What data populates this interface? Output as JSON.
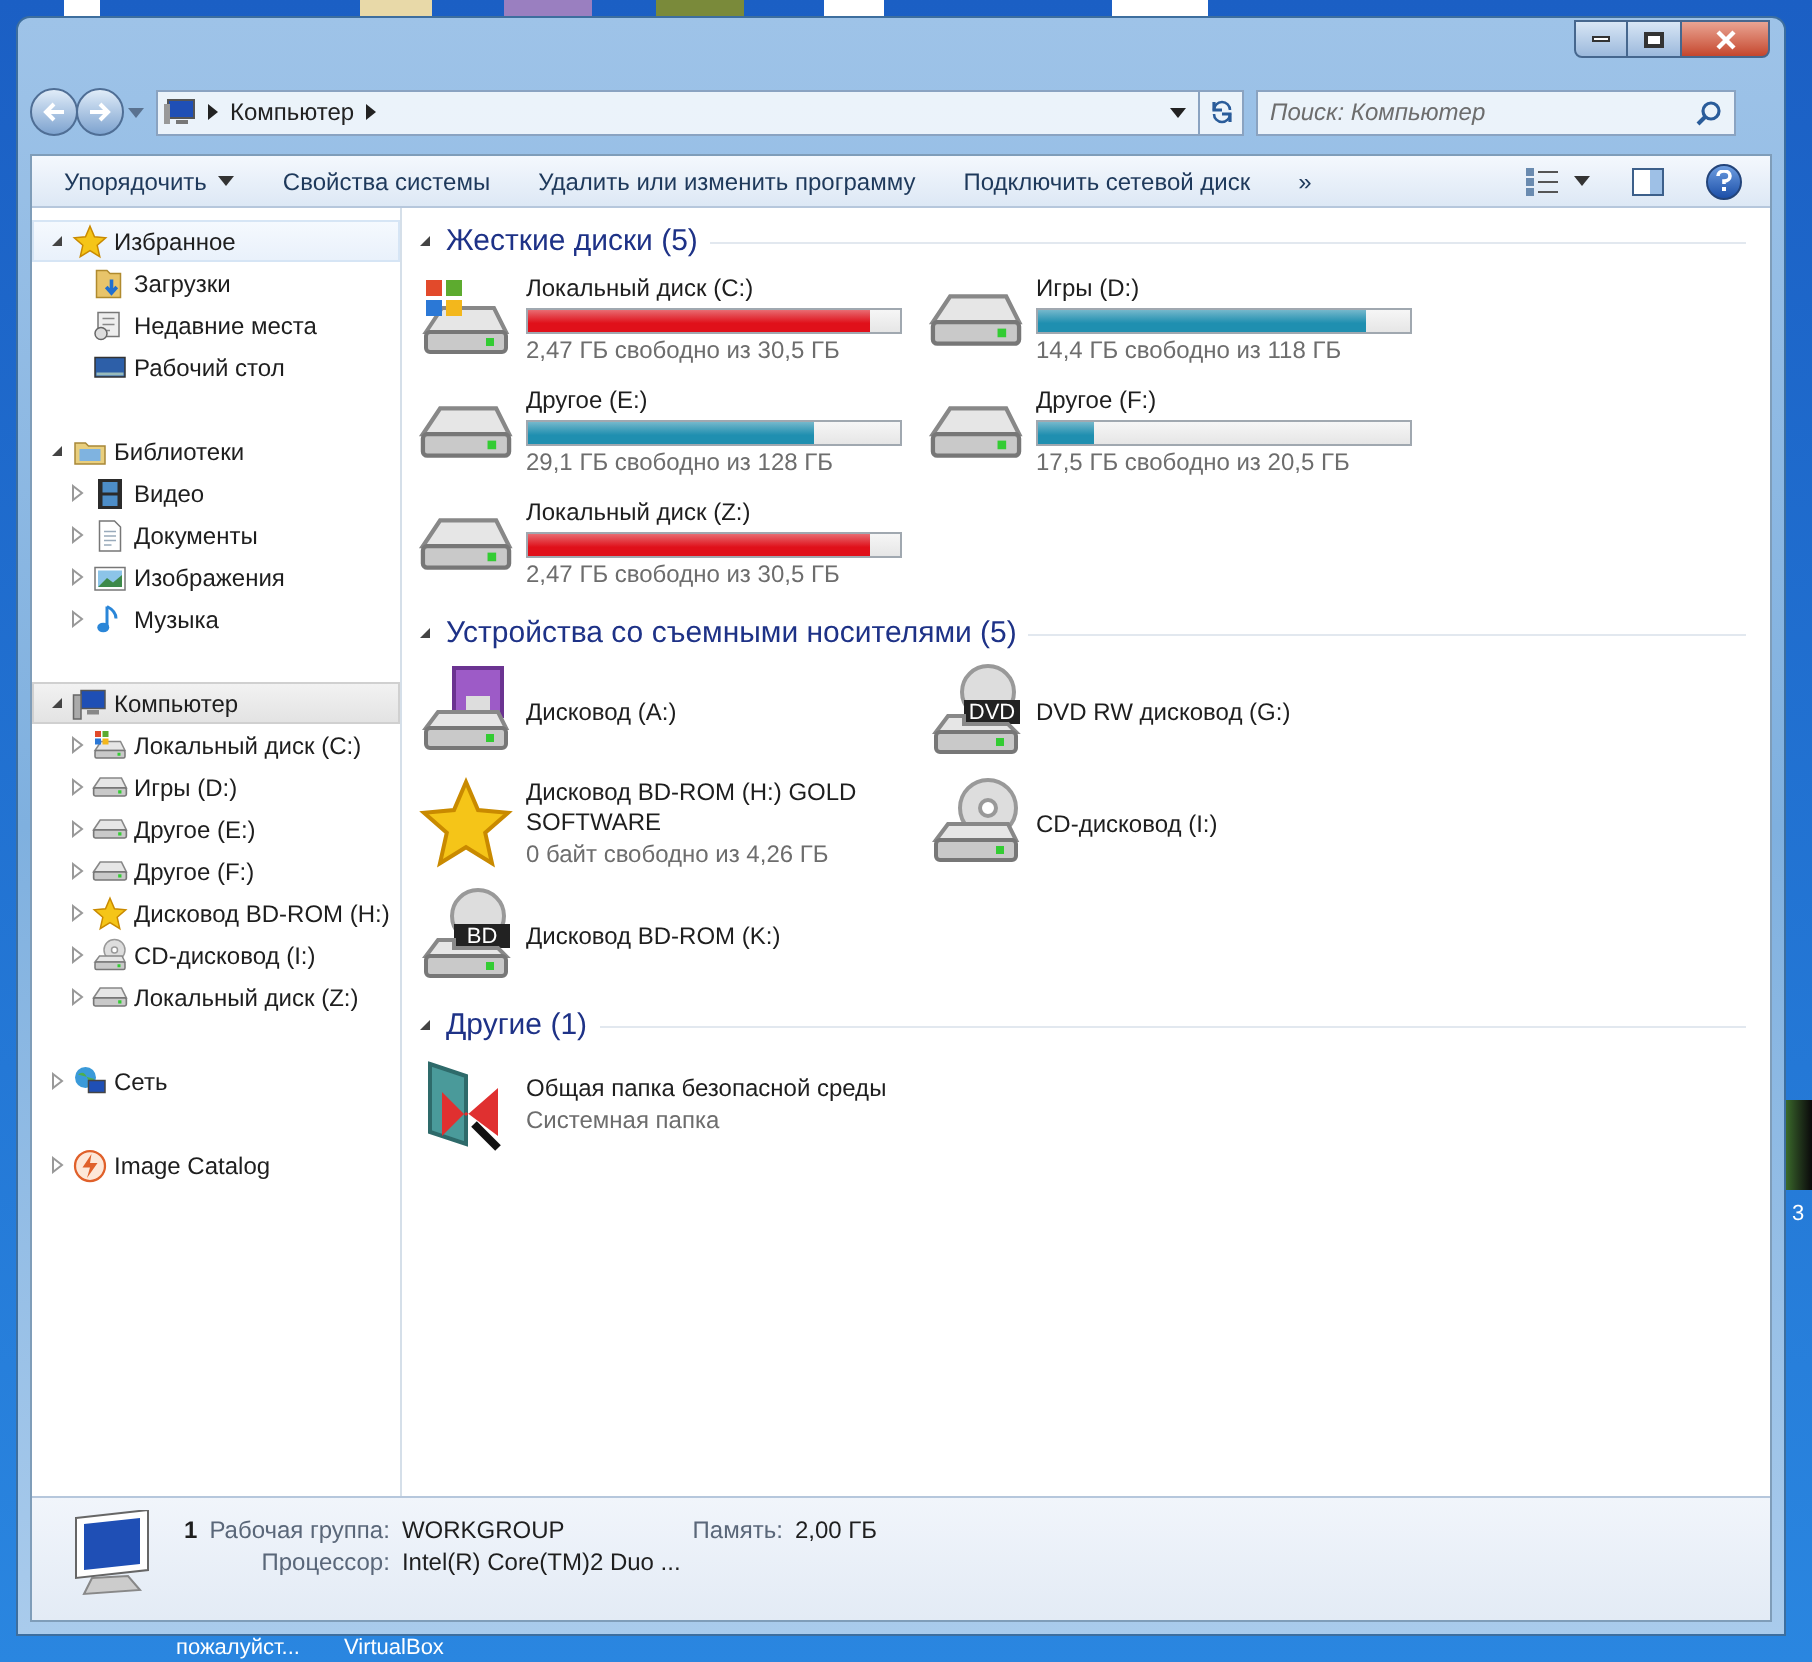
{
  "desktop": {
    "labels": [
      {
        "text": "пожалуйст..."
      },
      {
        "text": "VirtualBox"
      },
      {
        "text": "3"
      }
    ]
  },
  "address_bar": {
    "path": "Компьютер",
    "search_placeholder": "Поиск: Компьютер"
  },
  "toolbar": {
    "buttons": [
      {
        "label": "Упорядочить",
        "kind": "dropdown"
      },
      {
        "label": "Свойства системы",
        "kind": "plain"
      },
      {
        "label": "Удалить или изменить программу",
        "kind": "plain"
      },
      {
        "label": "Подключить сетевой диск",
        "kind": "plain"
      },
      {
        "label": "»",
        "kind": "plain"
      }
    ]
  },
  "sidebar": {
    "groups": [
      {
        "label": "Избранное",
        "kind": "star",
        "expanded": true,
        "selected": false,
        "hovered": true,
        "children": [
          {
            "label": "Загрузки",
            "kind": "downloads",
            "expandable": false
          },
          {
            "label": "Недавние места",
            "kind": "recent",
            "expandable": false
          },
          {
            "label": "Рабочий стол",
            "kind": "desktop",
            "expandable": false
          }
        ]
      },
      {
        "label": "Библиотеки",
        "kind": "library",
        "expanded": true,
        "selected": false,
        "hovered": false,
        "children": [
          {
            "label": "Видео",
            "kind": "video",
            "expandable": true
          },
          {
            "label": "Документы",
            "kind": "document",
            "expandable": true
          },
          {
            "label": "Изображения",
            "kind": "image",
            "expandable": true
          },
          {
            "label": "Музыка",
            "kind": "music",
            "expandable": true
          }
        ]
      },
      {
        "label": "Компьютер",
        "kind": "computer",
        "expanded": true,
        "selected": true,
        "hovered": false,
        "children": [
          {
            "label": "Локальный диск (C:)",
            "kind": "hdd-windows",
            "expandable": true
          },
          {
            "label": "Игры (D:)",
            "kind": "hdd",
            "expandable": true
          },
          {
            "label": "Другое (E:)",
            "kind": "hdd",
            "expandable": true
          },
          {
            "label": "Другое (F:)",
            "kind": "hdd",
            "expandable": true
          },
          {
            "label": "Дисковод BD-ROM (H:)",
            "kind": "star",
            "expandable": true
          },
          {
            "label": "CD-дисковод (I:)",
            "kind": "cd",
            "expandable": true
          },
          {
            "label": "Локальный диск (Z:)",
            "kind": "hdd",
            "expandable": true
          }
        ]
      },
      {
        "label": "Сеть",
        "kind": "network",
        "expanded": false,
        "selected": false,
        "hovered": false
      },
      {
        "label": "Image Catalog",
        "kind": "catalog",
        "expanded": false,
        "selected": false,
        "hovered": false
      }
    ]
  },
  "sections": [
    {
      "title": "Жесткие диски (5)",
      "expanded": true,
      "items": [
        {
          "name": "Локальный диск (C:)",
          "kind": "hdd-windows",
          "level": 0.92,
          "color": "#e0101a",
          "free": "2,47 ГБ свободно из 30,5 ГБ"
        },
        {
          "name": "Игры (D:)",
          "kind": "hdd",
          "level": 0.88,
          "color": "#1f8fb0",
          "free": "14,4 ГБ свободно из 118 ГБ"
        },
        {
          "name": "Другое (E:)",
          "kind": "hdd",
          "level": 0.77,
          "color": "#1f8fb0",
          "free": "29,1 ГБ свободно из 128 ГБ"
        },
        {
          "name": "Другое (F:)",
          "kind": "hdd",
          "level": 0.15,
          "color": "#1f8fb0",
          "free": "17,5 ГБ свободно из 20,5 ГБ"
        },
        {
          "name": "Локальный диск (Z:)",
          "kind": "hdd",
          "level": 0.92,
          "color": "#e0101a",
          "free": "2,47 ГБ свободно из 30,5 ГБ"
        }
      ]
    },
    {
      "title": "Устройства со съемными носителями (5)",
      "expanded": true,
      "items": [
        {
          "name": "Дисковод (A:)",
          "kind": "floppy"
        },
        {
          "name": "DVD RW дисковод (G:)",
          "kind": "dvd",
          "disc_label": "DVD"
        },
        {
          "name": "Дисковод BD-ROM (H:) GOLD SOFTWARE",
          "kind": "star",
          "free": "0 байт свободно из 4,26 ГБ"
        },
        {
          "name": "CD-дисковод (I:)",
          "kind": "cd"
        },
        {
          "name": "Дисковод BD-ROM (K:)",
          "kind": "dvd",
          "disc_label": "BD"
        }
      ]
    },
    {
      "title": "Другие (1)",
      "expanded": true,
      "items": [
        {
          "name": "Общая папка безопасной среды",
          "kind": "sandbox",
          "free": "Системная папка"
        }
      ]
    }
  ],
  "details": {
    "computer_name": "1",
    "fields": [
      {
        "label": "Рабочая группа:",
        "value": "WORKGROUP"
      },
      {
        "label": "Память:",
        "value": "2,00 ГБ"
      },
      {
        "label": "Процессор:",
        "value": "Intel(R) Core(TM)2 Duo ..."
      }
    ]
  }
}
